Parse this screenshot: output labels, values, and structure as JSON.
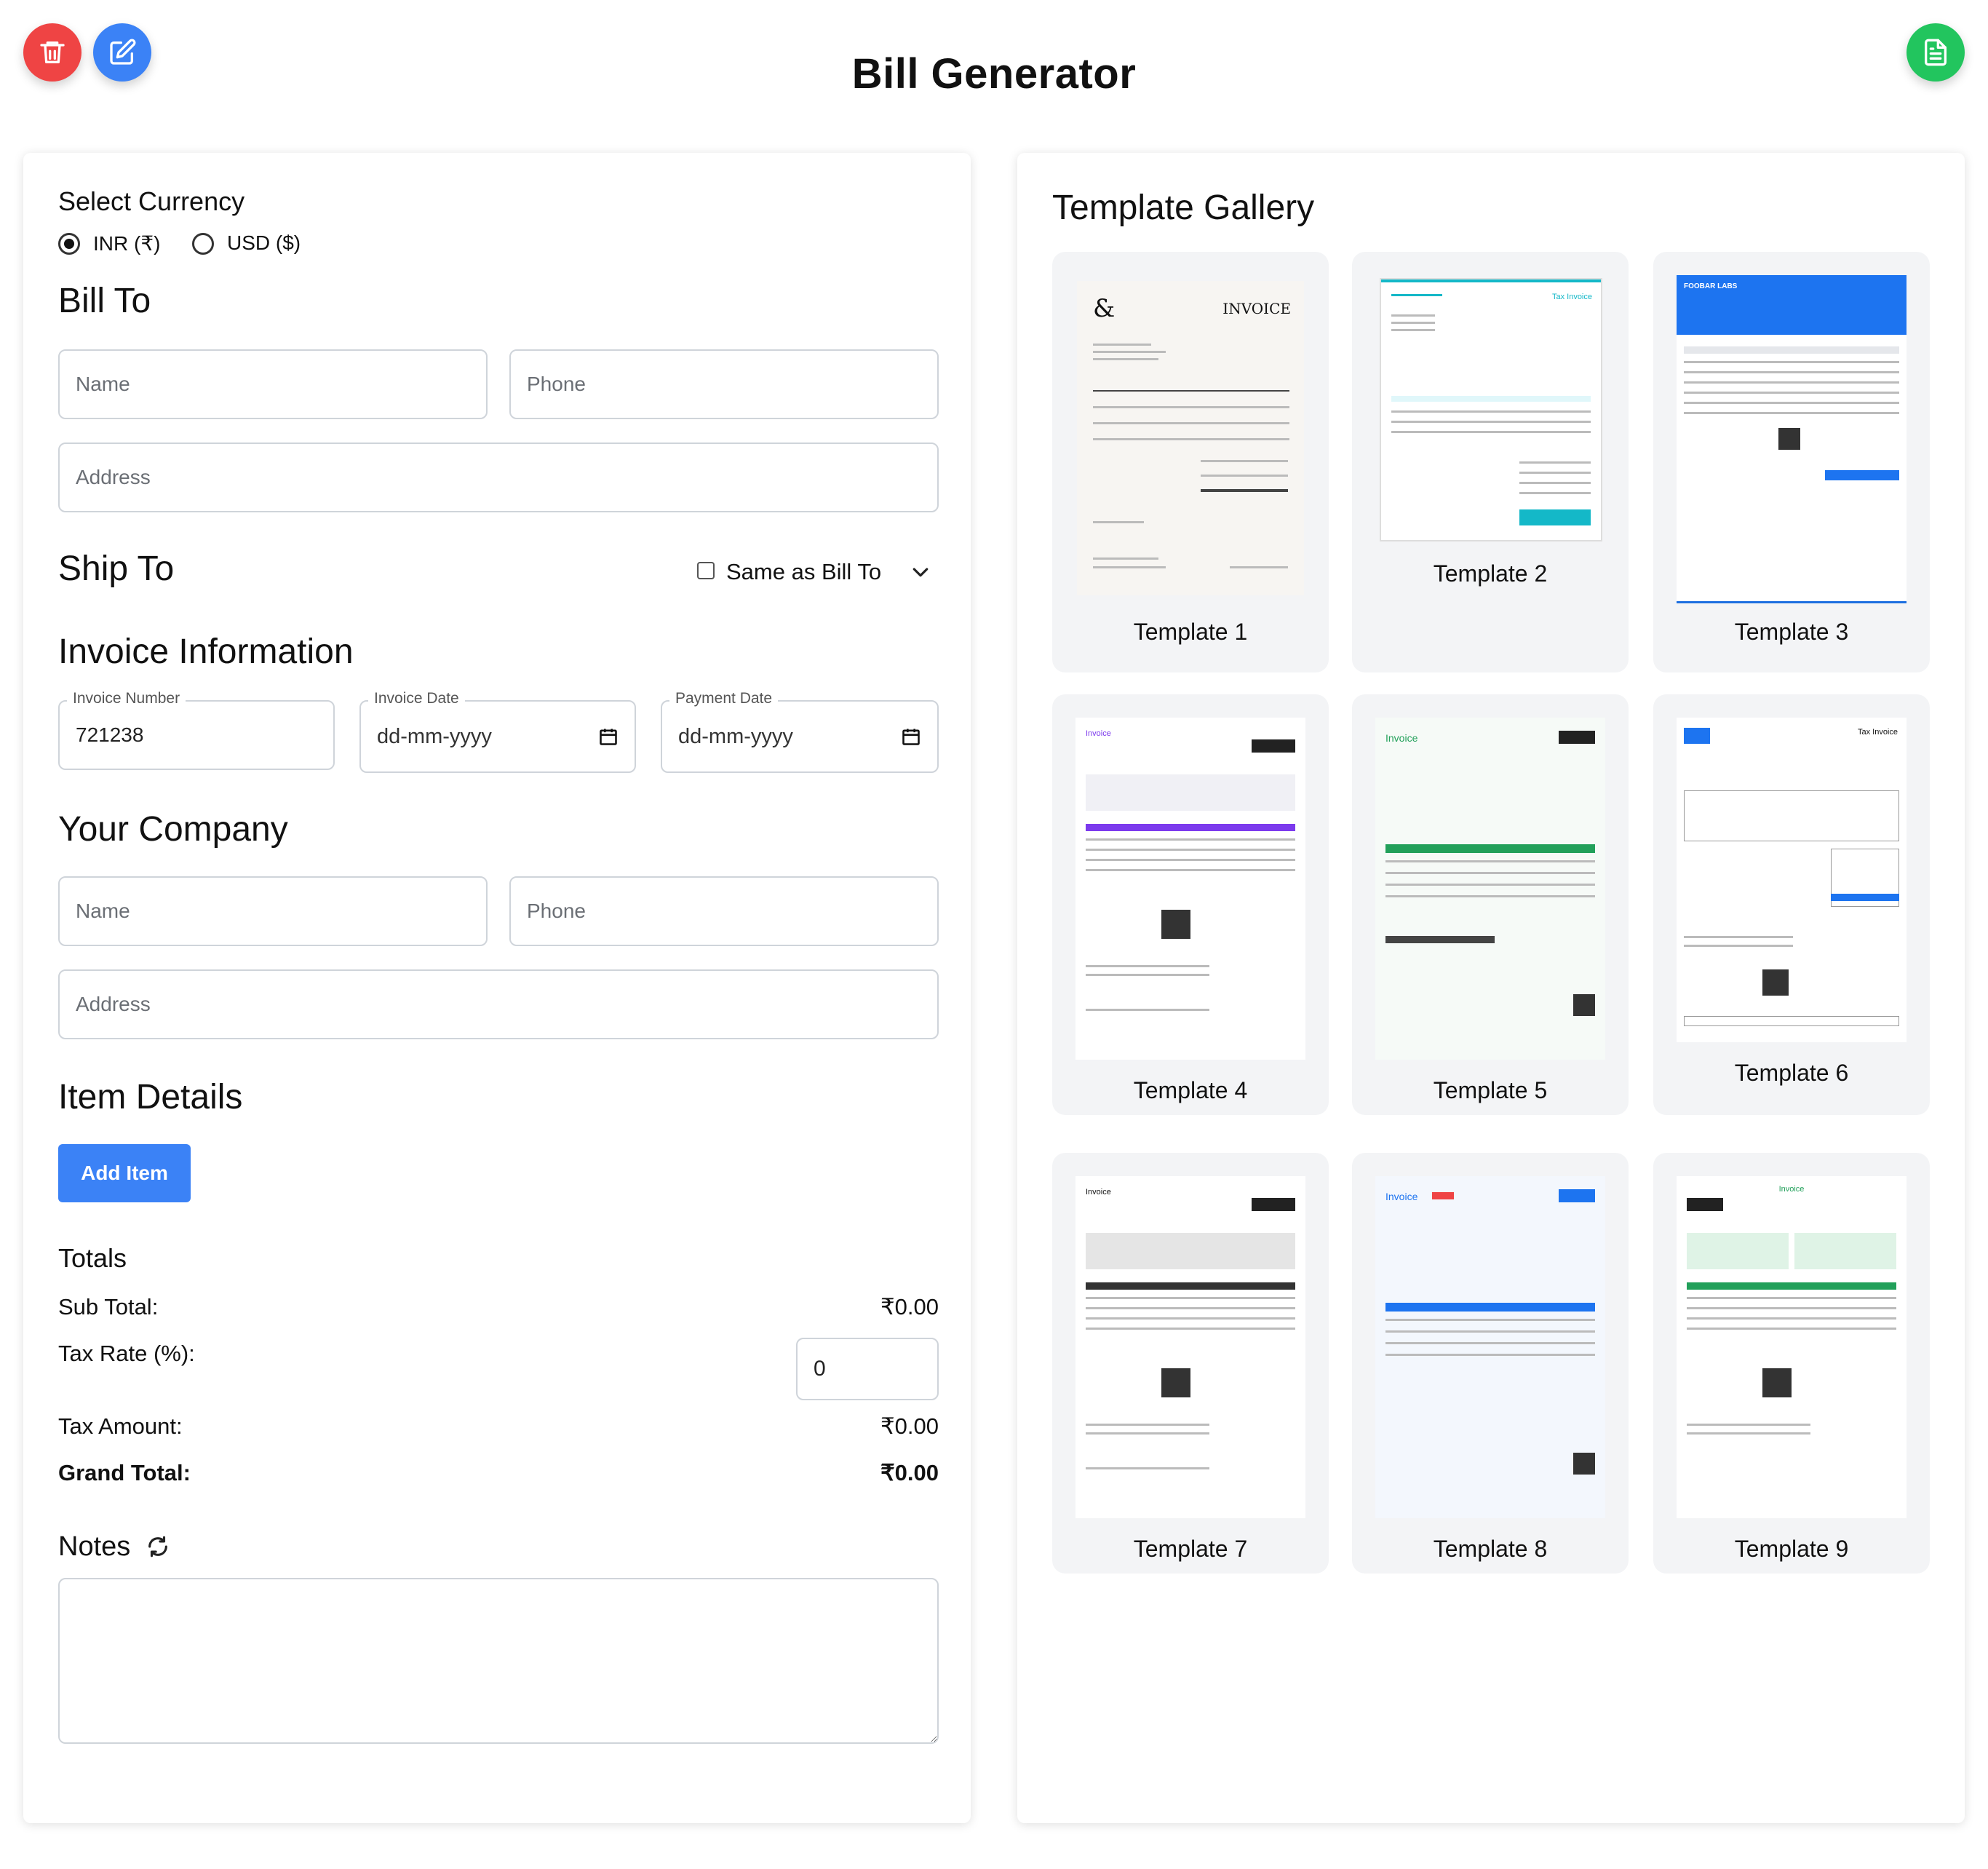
{
  "header": {
    "title": "Bill Generator"
  },
  "colors": {
    "delete": "#ef4444",
    "edit": "#3b82f6",
    "generate": "#22c55e",
    "primary": "#3b82f6"
  },
  "icons": {
    "delete": "trash-icon",
    "edit": "edit-icon",
    "generate": "document-icon"
  },
  "form": {
    "currency": {
      "heading": "Select Currency",
      "options": [
        "INR (₹)",
        "USD ($)"
      ],
      "selected": "INR (₹)"
    },
    "bill_to": {
      "heading": "Bill To",
      "name_placeholder": "Name",
      "phone_placeholder": "Phone",
      "address_placeholder": "Address"
    },
    "ship_to": {
      "heading": "Ship To",
      "same_label": "Same as Bill To"
    },
    "invoice": {
      "heading": "Invoice Information",
      "number_label": "Invoice Number",
      "number_value": "721238",
      "date_label": "Invoice Date",
      "date_value": "dd-mm-yyyy",
      "payment_label": "Payment Date",
      "payment_value": "dd-mm-yyyy"
    },
    "company": {
      "heading": "Your Company",
      "name_placeholder": "Name",
      "phone_placeholder": "Phone",
      "address_placeholder": "Address"
    },
    "items": {
      "heading": "Item Details",
      "add_label": "Add Item"
    },
    "totals": {
      "heading": "Totals",
      "subtotal_label": "Sub Total:",
      "subtotal_value": "₹0.00",
      "tax_rate_label": "Tax Rate (%):",
      "tax_rate_value": "0",
      "tax_amount_label": "Tax Amount:",
      "tax_amount_value": "₹0.00",
      "grand_label": "Grand Total:",
      "grand_value": "₹0.00"
    },
    "notes": {
      "heading": "Notes"
    }
  },
  "gallery": {
    "heading": "Template Gallery",
    "templates": [
      {
        "label": "Template 1",
        "thumb_title": "INVOICE"
      },
      {
        "label": "Template 2",
        "thumb_title": "Tax Invoice"
      },
      {
        "label": "Template 3",
        "thumb_title": "FOOBAR LABS"
      },
      {
        "label": "Template 4",
        "thumb_title": "Invoice"
      },
      {
        "label": "Template 5",
        "thumb_title": "Invoice"
      },
      {
        "label": "Template 6",
        "thumb_title": "Tax Invoice"
      },
      {
        "label": "Template 7",
        "thumb_title": "Invoice"
      },
      {
        "label": "Template 8",
        "thumb_title": "Invoice"
      },
      {
        "label": "Template 9",
        "thumb_title": "Invoice"
      }
    ]
  }
}
